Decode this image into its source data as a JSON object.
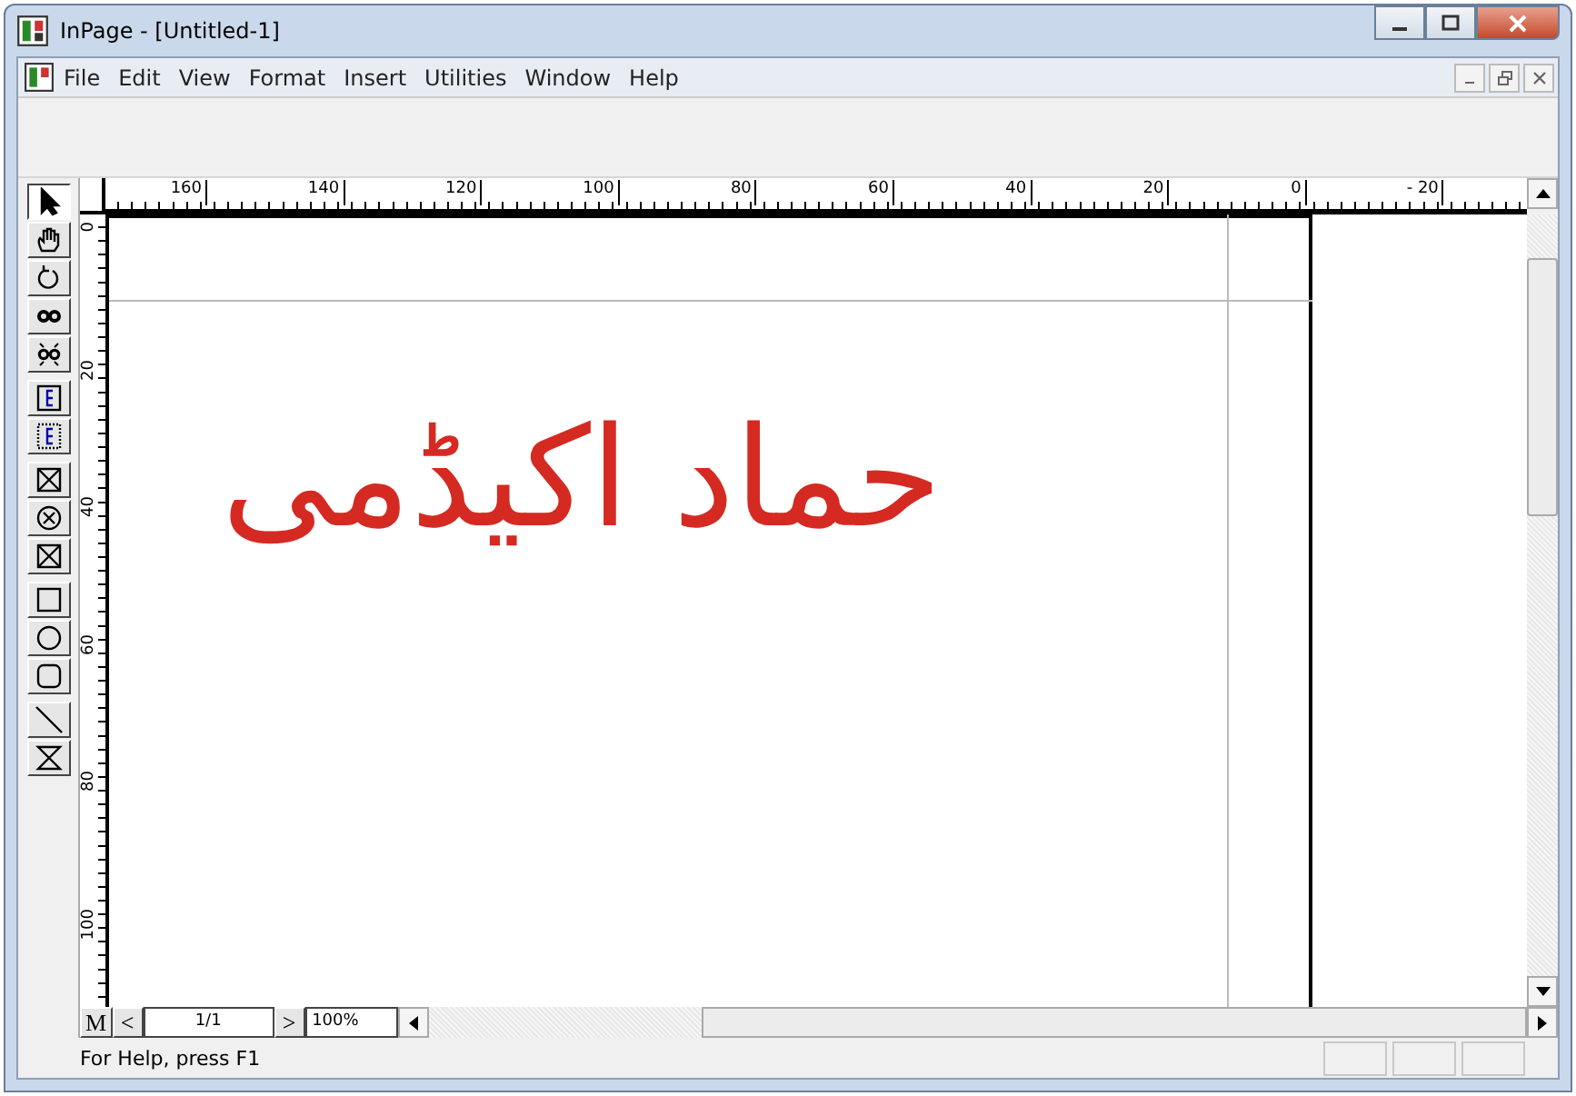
{
  "window": {
    "title": "InPage - [Untitled-1]"
  },
  "menu": [
    {
      "label": "File"
    },
    {
      "label": "Edit"
    },
    {
      "label": "View"
    },
    {
      "label": "Format"
    },
    {
      "label": "Insert"
    },
    {
      "label": "Utilities"
    },
    {
      "label": "Window"
    },
    {
      "label": "Help"
    }
  ],
  "tools": [
    {
      "kind": "pointer",
      "selected": true
    },
    {
      "kind": "hand",
      "selected": false
    },
    {
      "kind": "rotate",
      "selected": false
    },
    {
      "kind": "link",
      "selected": false
    },
    {
      "kind": "unlink",
      "selected": false
    },
    {
      "kind": "text",
      "selected": false
    },
    {
      "kind": "text-dotted",
      "selected": false
    },
    {
      "kind": "box-cross",
      "selected": false
    },
    {
      "kind": "circle-cross",
      "selected": false
    },
    {
      "kind": "box-cross",
      "selected": false
    },
    {
      "kind": "rect",
      "selected": false
    },
    {
      "kind": "ellipse",
      "selected": false
    },
    {
      "kind": "rounded-rect",
      "selected": false
    },
    {
      "kind": "line",
      "selected": false
    },
    {
      "kind": "hourglass",
      "selected": false
    }
  ],
  "horizontal_ruler": [
    "160",
    "140",
    "120",
    "100",
    "80",
    "60",
    "40",
    "20",
    "0",
    "- 20"
  ],
  "vertical_ruler": [
    "0",
    "20",
    "40",
    "60",
    "80",
    "100"
  ],
  "document": {
    "text": "حماد اکیڈمی"
  },
  "page_nav": {
    "master": "M",
    "prev": "<",
    "page": "1/1",
    "next": ">",
    "zoom": "100%"
  },
  "status_bar": {
    "text": "For Help, press F1"
  }
}
